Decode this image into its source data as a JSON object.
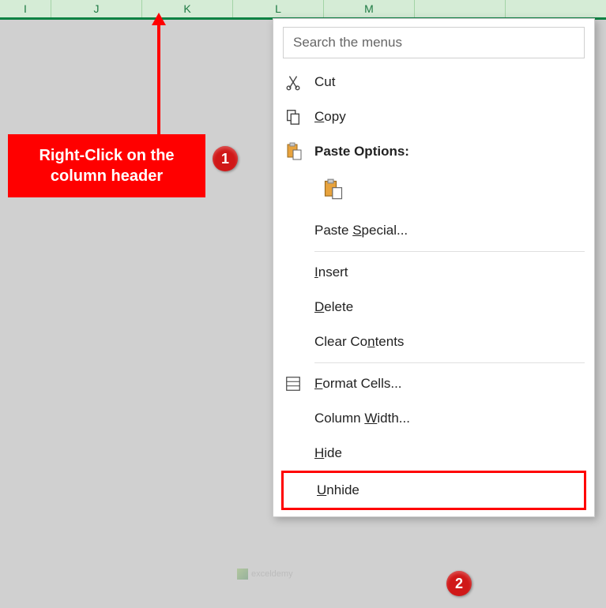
{
  "columns": [
    "I",
    "J",
    "K",
    "L",
    "M"
  ],
  "callout": {
    "line1": "Right-Click on the",
    "line2": "column header"
  },
  "badges": {
    "one": "1",
    "two": "2"
  },
  "menu": {
    "search_placeholder": "Search the menus",
    "cut": "Cut",
    "copy": "Copy",
    "paste_options": "Paste Options:",
    "paste_special": "Paste Special...",
    "insert": "Insert",
    "delete": "Delete",
    "clear_contents": "Clear Contents",
    "format_cells": "Format Cells...",
    "column_width": "Column Width...",
    "hide": "Hide",
    "unhide": "Unhide"
  },
  "watermark": "exceldemy"
}
